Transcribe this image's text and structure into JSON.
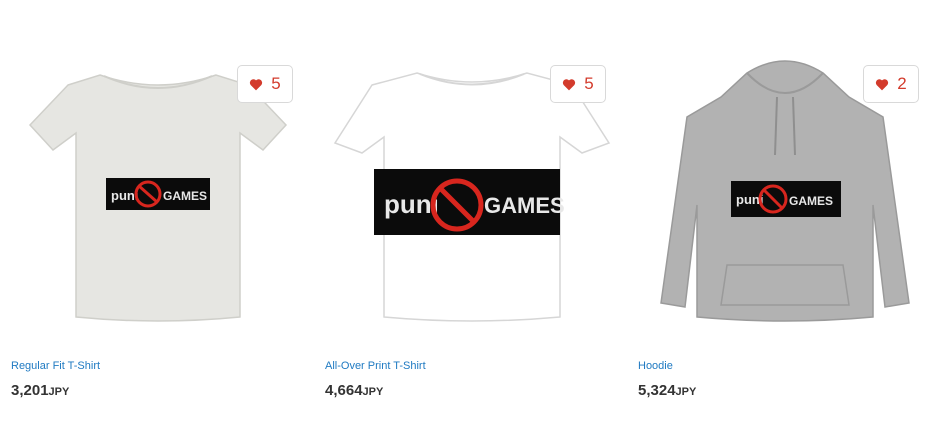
{
  "products": [
    {
      "name": "Regular Fit T-Shirt",
      "price": "3,201",
      "currency": "JPY",
      "likes": "5",
      "garment_color": "#e6e6e2",
      "print_left": "puni",
      "print_right": "GAMES"
    },
    {
      "name": "All-Over Print T-Shirt",
      "price": "4,664",
      "currency": "JPY",
      "likes": "5",
      "garment_color": "#ffffff",
      "print_left": "puni",
      "print_right": "GAMES"
    },
    {
      "name": "Hoodie",
      "price": "5,324",
      "currency": "JPY",
      "likes": "2",
      "garment_color": "#b2b2b2",
      "print_left": "puni",
      "print_right": "GAMES"
    }
  ],
  "colors": {
    "accent": "#d33b2c",
    "link": "#1f7ac2",
    "price": "#333333"
  },
  "icons": {
    "like": "heart-icon"
  }
}
